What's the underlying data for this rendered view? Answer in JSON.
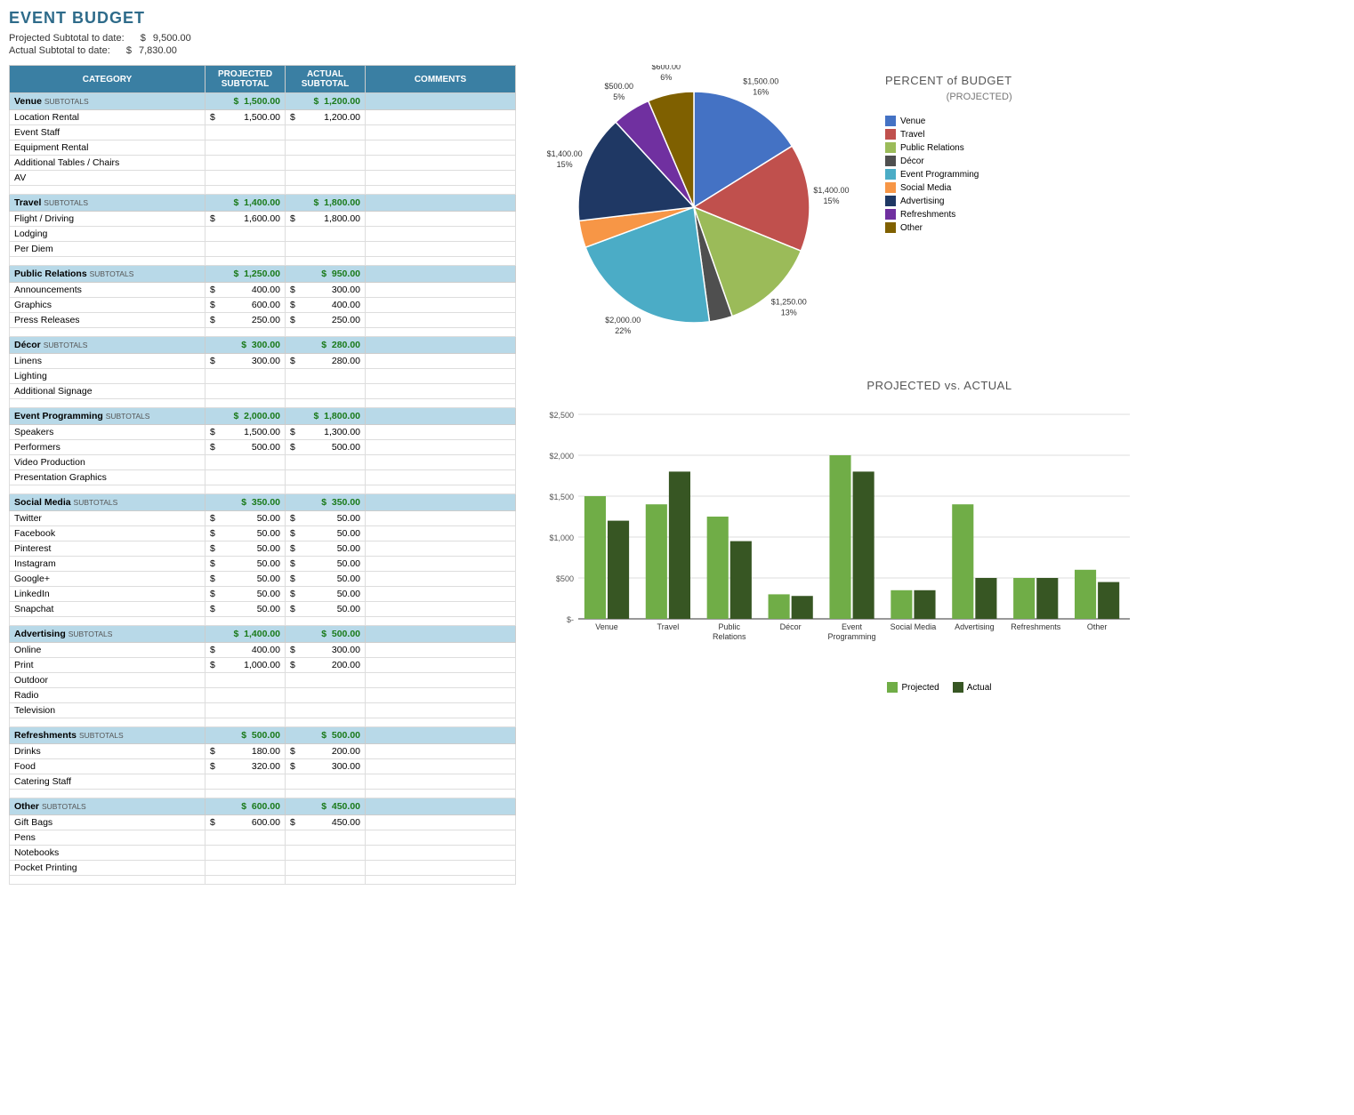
{
  "title": "EVENT BUDGET",
  "projected_subtotal": {
    "label": "Projected Subtotal to date:",
    "symbol": "$",
    "value": "9,500.00"
  },
  "actual_subtotal": {
    "label": "Actual Subtotal to date:",
    "symbol": "$",
    "value": "7,830.00"
  },
  "table": {
    "headers": [
      "CATEGORY",
      "PROJECTED SUBTOTAL",
      "ACTUAL SUBTOTAL",
      "COMMENTS"
    ],
    "sections": [
      {
        "name": "Venue",
        "subtotal_label": "SUBTOTALS",
        "projected": "1,500.00",
        "actual": "1,200.00",
        "rows": [
          {
            "item": "Location Rental",
            "proj_sym": "$",
            "proj": "1,500.00",
            "act_sym": "$",
            "act": "1,200.00"
          },
          {
            "item": "Event Staff",
            "proj_sym": "",
            "proj": "",
            "act_sym": "",
            "act": ""
          },
          {
            "item": "Equipment Rental",
            "proj_sym": "",
            "proj": "",
            "act_sym": "",
            "act": ""
          },
          {
            "item": "Additional Tables / Chairs",
            "proj_sym": "",
            "proj": "",
            "act_sym": "",
            "act": ""
          },
          {
            "item": "AV",
            "proj_sym": "",
            "proj": "",
            "act_sym": "",
            "act": ""
          }
        ]
      },
      {
        "name": "Travel",
        "subtotal_label": "SUBTOTALS",
        "projected": "1,400.00",
        "actual": "1,800.00",
        "rows": [
          {
            "item": "Flight / Driving",
            "proj_sym": "$",
            "proj": "1,600.00",
            "act_sym": "$",
            "act": "1,800.00"
          },
          {
            "item": "Lodging",
            "proj_sym": "",
            "proj": "",
            "act_sym": "",
            "act": ""
          },
          {
            "item": "Per Diem",
            "proj_sym": "",
            "proj": "",
            "act_sym": "",
            "act": ""
          }
        ]
      },
      {
        "name": "Public Relations",
        "subtotal_label": "SUBTOTALS",
        "projected": "1,250.00",
        "actual": "950.00",
        "rows": [
          {
            "item": "Announcements",
            "proj_sym": "$",
            "proj": "400.00",
            "act_sym": "$",
            "act": "300.00"
          },
          {
            "item": "Graphics",
            "proj_sym": "$",
            "proj": "600.00",
            "act_sym": "$",
            "act": "400.00"
          },
          {
            "item": "Press Releases",
            "proj_sym": "$",
            "proj": "250.00",
            "act_sym": "$",
            "act": "250.00"
          }
        ]
      },
      {
        "name": "Décor",
        "subtotal_label": "SUBTOTALS",
        "projected": "300.00",
        "actual": "280.00",
        "rows": [
          {
            "item": "Linens",
            "proj_sym": "$",
            "proj": "300.00",
            "act_sym": "$",
            "act": "280.00"
          },
          {
            "item": "Lighting",
            "proj_sym": "",
            "proj": "",
            "act_sym": "",
            "act": ""
          },
          {
            "item": "Additional Signage",
            "proj_sym": "",
            "proj": "",
            "act_sym": "",
            "act": ""
          }
        ]
      },
      {
        "name": "Event Programming",
        "subtotal_label": "SUBTOTALS",
        "projected": "2,000.00",
        "actual": "1,800.00",
        "rows": [
          {
            "item": "Speakers",
            "proj_sym": "$",
            "proj": "1,500.00",
            "act_sym": "$",
            "act": "1,300.00"
          },
          {
            "item": "Performers",
            "proj_sym": "$",
            "proj": "500.00",
            "act_sym": "$",
            "act": "500.00"
          },
          {
            "item": "Video Production",
            "proj_sym": "",
            "proj": "",
            "act_sym": "",
            "act": ""
          },
          {
            "item": "Presentation Graphics",
            "proj_sym": "",
            "proj": "",
            "act_sym": "",
            "act": ""
          }
        ]
      },
      {
        "name": "Social Media",
        "subtotal_label": "SUBTOTALS",
        "projected": "350.00",
        "actual": "350.00",
        "rows": [
          {
            "item": "Twitter",
            "proj_sym": "$",
            "proj": "50.00",
            "act_sym": "$",
            "act": "50.00"
          },
          {
            "item": "Facebook",
            "proj_sym": "$",
            "proj": "50.00",
            "act_sym": "$",
            "act": "50.00"
          },
          {
            "item": "Pinterest",
            "proj_sym": "$",
            "proj": "50.00",
            "act_sym": "$",
            "act": "50.00"
          },
          {
            "item": "Instagram",
            "proj_sym": "$",
            "proj": "50.00",
            "act_sym": "$",
            "act": "50.00"
          },
          {
            "item": "Google+",
            "proj_sym": "$",
            "proj": "50.00",
            "act_sym": "$",
            "act": "50.00"
          },
          {
            "item": "LinkedIn",
            "proj_sym": "$",
            "proj": "50.00",
            "act_sym": "$",
            "act": "50.00"
          },
          {
            "item": "Snapchat",
            "proj_sym": "$",
            "proj": "50.00",
            "act_sym": "$",
            "act": "50.00"
          }
        ]
      },
      {
        "name": "Advertising",
        "subtotal_label": "SUBTOTALS",
        "projected": "1,400.00",
        "actual": "500.00",
        "rows": [
          {
            "item": "Online",
            "proj_sym": "$",
            "proj": "400.00",
            "act_sym": "$",
            "act": "300.00"
          },
          {
            "item": "Print",
            "proj_sym": "$",
            "proj": "1,000.00",
            "act_sym": "$",
            "act": "200.00"
          },
          {
            "item": "Outdoor",
            "proj_sym": "",
            "proj": "",
            "act_sym": "",
            "act": ""
          },
          {
            "item": "Radio",
            "proj_sym": "",
            "proj": "",
            "act_sym": "",
            "act": ""
          },
          {
            "item": "Television",
            "proj_sym": "",
            "proj": "",
            "act_sym": "",
            "act": ""
          }
        ]
      },
      {
        "name": "Refreshments",
        "subtotal_label": "SUBTOTALS",
        "projected": "500.00",
        "actual": "500.00",
        "rows": [
          {
            "item": "Drinks",
            "proj_sym": "$",
            "proj": "180.00",
            "act_sym": "$",
            "act": "200.00"
          },
          {
            "item": "Food",
            "proj_sym": "$",
            "proj": "320.00",
            "act_sym": "$",
            "act": "300.00"
          },
          {
            "item": "Catering Staff",
            "proj_sym": "",
            "proj": "",
            "act_sym": "",
            "act": ""
          }
        ]
      },
      {
        "name": "Other",
        "subtotal_label": "SUBTOTALS",
        "projected": "600.00",
        "actual": "450.00",
        "rows": [
          {
            "item": "Gift Bags",
            "proj_sym": "$",
            "proj": "600.00",
            "act_sym": "$",
            "act": "450.00"
          },
          {
            "item": "Pens",
            "proj_sym": "",
            "proj": "",
            "act_sym": "",
            "act": ""
          },
          {
            "item": "Notebooks",
            "proj_sym": "",
            "proj": "",
            "act_sym": "",
            "act": ""
          },
          {
            "item": "Pocket Printing",
            "proj_sym": "",
            "proj": "",
            "act_sym": "",
            "act": ""
          }
        ]
      }
    ]
  },
  "pie_chart": {
    "title": "PERCENT of BUDGET",
    "subtitle": "(PROJECTED)",
    "slices": [
      {
        "label": "Venue",
        "value": 1500,
        "percent": "16%",
        "color": "#4472c4",
        "label_pos": "$1,500.00\n16%"
      },
      {
        "label": "Travel",
        "value": 1400,
        "percent": "15%",
        "color": "#c0504d"
      },
      {
        "label": "Public Relations",
        "value": 1250,
        "percent": "13%",
        "color": "#9bbb59"
      },
      {
        "label": "Décor",
        "value": 300,
        "percent": "3%",
        "color": "#4f4f4f"
      },
      {
        "label": "Event Programming",
        "value": 2000,
        "percent": "21%",
        "color": "#4bacc6"
      },
      {
        "label": "Social Media",
        "value": 350,
        "percent": "4%",
        "color": "#f79646"
      },
      {
        "label": "Advertising",
        "value": 1400,
        "percent": "15%",
        "color": "#1f3864"
      },
      {
        "label": "Refreshments",
        "value": 500,
        "percent": "5%",
        "color": "#7030a0"
      },
      {
        "label": "Other",
        "value": 600,
        "percent": "6%",
        "color": "#7f6000"
      }
    ]
  },
  "bar_chart": {
    "title": "PROJECTED vs. ACTUAL",
    "y_labels": [
      "$2,500",
      "$2,000",
      "$1,500",
      "$1,000",
      "$500",
      "$-"
    ],
    "categories": [
      "Venue",
      "Travel",
      "Public Relations",
      "Décor",
      "Event Programming",
      "Social Media",
      "Advertising",
      "Refreshments",
      "Other"
    ],
    "projected": [
      1500,
      1400,
      1250,
      300,
      2000,
      350,
      1400,
      500,
      600
    ],
    "actual": [
      1200,
      1800,
      950,
      280,
      1800,
      350,
      500,
      500,
      450
    ],
    "legend": {
      "projected": "Projected",
      "actual": "Actual"
    },
    "colors": {
      "projected": "#70ad47",
      "actual": "#375623"
    }
  }
}
